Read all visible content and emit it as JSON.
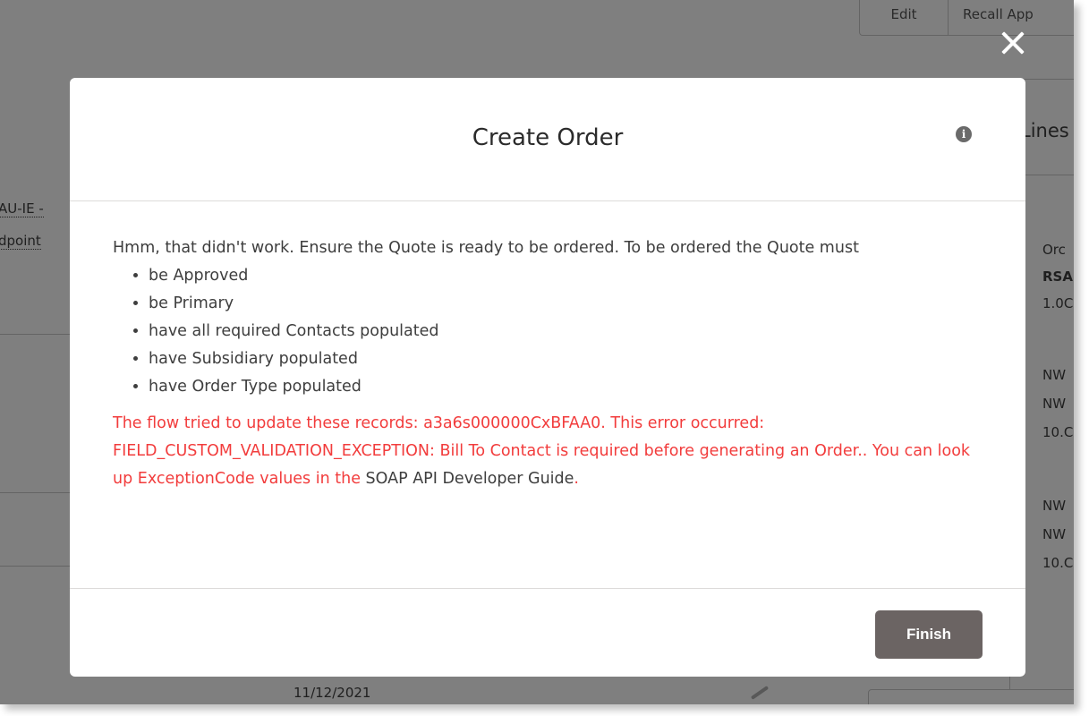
{
  "background": {
    "buttons": {
      "edit": "Edit",
      "recall": "Recall App"
    },
    "section_label": "Lines",
    "left_text": {
      "line1": "AU-IE -",
      "line2": "dpoint"
    },
    "right_column": [
      "Orc",
      "RSA",
      "1.0C",
      "NW",
      "NW",
      "10.C",
      "NW",
      "NW",
      "10.C"
    ],
    "date": "11/12/2021"
  },
  "modal": {
    "title": "Create Order",
    "info_icon": "info-icon",
    "intro": "Hmm, that didn't work. Ensure the Quote is ready to be ordered. To be ordered the Quote must",
    "requirements": [
      "be Approved",
      "be Primary",
      "have all required Contacts populated",
      "have Subsidiary populated",
      "have Order Type populated"
    ],
    "error_message": "The flow tried to update these records: a3a6s000000CxBFAA0. This error occurred: FIELD_CUSTOM_VALIDATION_EXCEPTION: Bill To Contact is required before generating an Order.. You can look up ExceptionCode values in the",
    "error_link": "SOAP API Developer Guide",
    "error_suffix": ".",
    "finish_label": "Finish",
    "close_icon": "close-icon"
  },
  "colors": {
    "error": "#f23c3c",
    "finish_button": "#6b6463",
    "overlay": "rgba(0,0,0,0.5)"
  }
}
